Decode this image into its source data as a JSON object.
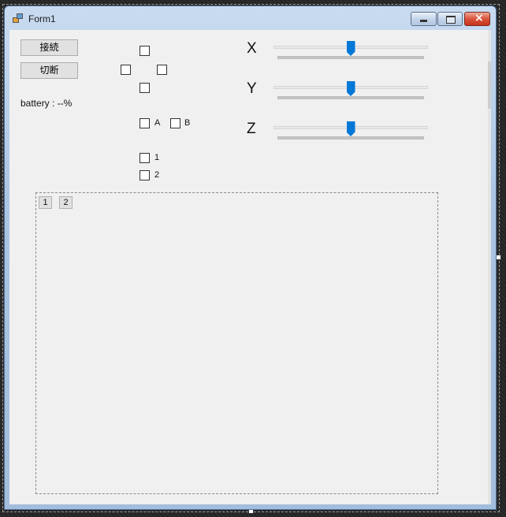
{
  "window": {
    "title": "Form1"
  },
  "buttons": {
    "connect_label": "接続",
    "disconnect_label": "切断"
  },
  "battery": {
    "text": "battery : --%"
  },
  "dpad": {
    "up": false,
    "left": false,
    "right": false,
    "down": false
  },
  "face_buttons": [
    {
      "label": "A",
      "checked": false
    },
    {
      "label": "B",
      "checked": false
    }
  ],
  "player_checks": [
    {
      "label": "1",
      "checked": false
    },
    {
      "label": "2",
      "checked": false
    }
  ],
  "sliders": [
    {
      "axis": "X",
      "value": 0.5
    },
    {
      "axis": "Y",
      "value": 0.5
    },
    {
      "axis": "Z",
      "value": 0.5
    }
  ],
  "panel_buttons": [
    "1",
    "2"
  ],
  "colors": {
    "accent": "#0078d7",
    "client_bg": "#f0f0f0",
    "close_red": "#d9533c"
  }
}
